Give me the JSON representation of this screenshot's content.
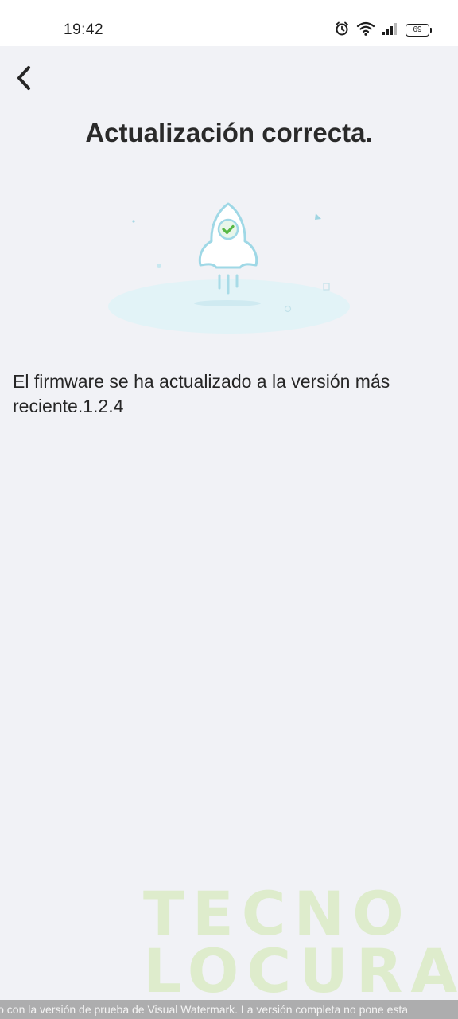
{
  "status_bar": {
    "time": "19:42",
    "battery_level": "69",
    "icons": [
      "alarm-icon",
      "wifi-icon",
      "signal-icon",
      "battery-icon"
    ]
  },
  "header": {
    "back_icon": "chevron-left-icon",
    "title": "Actualización correcta."
  },
  "illustration": {
    "icon": "rocket-check-icon"
  },
  "message": {
    "text": "El firmware se ha actualizado a la versión más reciente.1.2.4"
  },
  "watermark": {
    "logo_line1": "TECNO",
    "logo_line2": "LOCURA",
    "banner": "lo con la versión de prueba de Visual Watermark. La versión completa no pone esta"
  },
  "colors": {
    "background": "#f1f2f6",
    "rocket_outline": "#9fd8e6",
    "check": "#57b845"
  }
}
